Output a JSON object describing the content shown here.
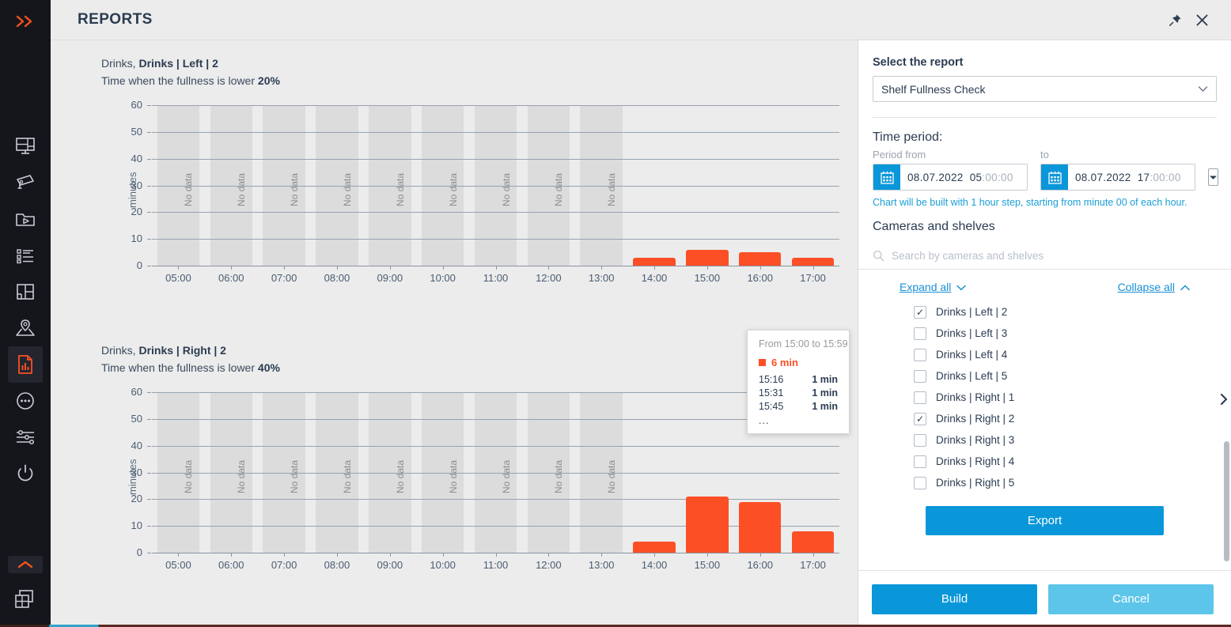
{
  "rail": {
    "expand_icon": "double-chevron-right-icon",
    "items": [
      {
        "name": "video-wall-icon",
        "label": "Video wall"
      },
      {
        "name": "camera-icon",
        "label": "Cameras"
      },
      {
        "name": "archive-folder-play-icon",
        "label": "Archive"
      },
      {
        "name": "events-list-icon",
        "label": "Events"
      },
      {
        "name": "layouts-icon",
        "label": "Layouts"
      },
      {
        "name": "map-pin-icon",
        "label": "Maps"
      },
      {
        "name": "reports-icon",
        "label": "Reports",
        "active": true
      },
      {
        "name": "more-dots-icon",
        "label": "More"
      },
      {
        "name": "settings-sliders-icon",
        "label": "Settings"
      },
      {
        "name": "power-icon",
        "label": "Power"
      }
    ],
    "collapse_icon": "chevron-up-icon",
    "grid_icon": "windows-grid-icon"
  },
  "titlebar": {
    "title": "REPORTS",
    "pin_icon": "pin-icon",
    "close_icon": "close-icon"
  },
  "charts": [
    {
      "title_prefix": "Drinks,",
      "title_bold": "Drinks | Left | 2",
      "subtitle_prefix": "Time when the fullness is lower",
      "subtitle_bold": "20%"
    },
    {
      "title_prefix": "Drinks,",
      "title_bold": "Drinks | Right | 2",
      "subtitle_prefix": "Time when the fullness is lower",
      "subtitle_bold": "40%"
    }
  ],
  "chart_data": [
    {
      "type": "bar",
      "title": "Drinks, Drinks | Left | 2",
      "subtitle": "Time when the fullness is lower 20%",
      "xlabel": "",
      "ylabel": "minutes",
      "ylim": [
        0,
        60
      ],
      "yticks": [
        0,
        10,
        20,
        30,
        40,
        50,
        60
      ],
      "categories": [
        "05:00",
        "06:00",
        "07:00",
        "08:00",
        "09:00",
        "10:00",
        "11:00",
        "12:00",
        "13:00",
        "14:00",
        "15:00",
        "16:00",
        "17:00"
      ],
      "values": [
        null,
        null,
        null,
        null,
        null,
        null,
        null,
        null,
        null,
        3,
        6,
        5,
        3
      ],
      "no_data_labels": [
        "05:00",
        "06:00",
        "07:00",
        "08:00",
        "09:00",
        "10:00",
        "11:00",
        "12:00",
        "13:00"
      ],
      "no_data_text": "No data",
      "bar_color": "#fc4f26",
      "grid": true,
      "legend": "none"
    },
    {
      "type": "bar",
      "title": "Drinks, Drinks | Right | 2",
      "subtitle": "Time when the fullness is lower 40%",
      "xlabel": "",
      "ylabel": "minutes",
      "ylim": [
        0,
        60
      ],
      "yticks": [
        0,
        10,
        20,
        30,
        40,
        50,
        60
      ],
      "categories": [
        "05:00",
        "06:00",
        "07:00",
        "08:00",
        "09:00",
        "10:00",
        "11:00",
        "12:00",
        "13:00",
        "14:00",
        "15:00",
        "16:00",
        "17:00"
      ],
      "values": [
        null,
        null,
        null,
        null,
        null,
        null,
        null,
        null,
        null,
        4,
        21,
        19,
        8
      ],
      "no_data_labels": [
        "05:00",
        "06:00",
        "07:00",
        "08:00",
        "09:00",
        "10:00",
        "11:00",
        "12:00",
        "13:00"
      ],
      "no_data_text": "No data",
      "bar_color": "#fc4f26",
      "grid": true,
      "legend": "none"
    }
  ],
  "tooltip": {
    "header": "From 15:00 to 15:59",
    "total": "6 min",
    "rows": [
      {
        "time": "15:16",
        "value": "1 min"
      },
      {
        "time": "15:31",
        "value": "1 min"
      },
      {
        "time": "15:45",
        "value": "1 min"
      }
    ],
    "more": "..."
  },
  "panel": {
    "report_label": "Select the report",
    "report_value": "Shelf Fullness Check",
    "time_period_label": "Time period:",
    "from_caption": "Period from",
    "to_caption": "to",
    "from_date": "08.07.2022",
    "from_time_hh": "05",
    "from_time_rest": ":00:00",
    "to_date": "08.07.2022",
    "to_time_hh": "17",
    "to_time_rest": ":00:00",
    "hint": "Chart will be built with 1 hour step, starting from minute 00 of each hour.",
    "cameras_label": "Cameras and shelves",
    "search_placeholder": "Search by cameras and shelves",
    "search_value": "",
    "expand_all": "Expand all",
    "collapse_all": "Collapse all",
    "tree": [
      {
        "label": "Drinks | Left | 2",
        "checked": true
      },
      {
        "label": "Drinks | Left | 3",
        "checked": false
      },
      {
        "label": "Drinks | Left | 4",
        "checked": false
      },
      {
        "label": "Drinks | Left | 5",
        "checked": false
      },
      {
        "label": "Drinks | Right | 1",
        "checked": false
      },
      {
        "label": "Drinks | Right | 2",
        "checked": true
      },
      {
        "label": "Drinks | Right | 3",
        "checked": false
      },
      {
        "label": "Drinks | Right | 4",
        "checked": false
      },
      {
        "label": "Drinks | Right | 5",
        "checked": false
      }
    ],
    "export_label": "Export",
    "build_label": "Build",
    "cancel_label": "Cancel"
  },
  "colors": {
    "accent_blue": "#0a97d9",
    "accent_orange": "#fc4f26",
    "rail_bg": "#14161c",
    "chart_bg": "#ececec"
  }
}
